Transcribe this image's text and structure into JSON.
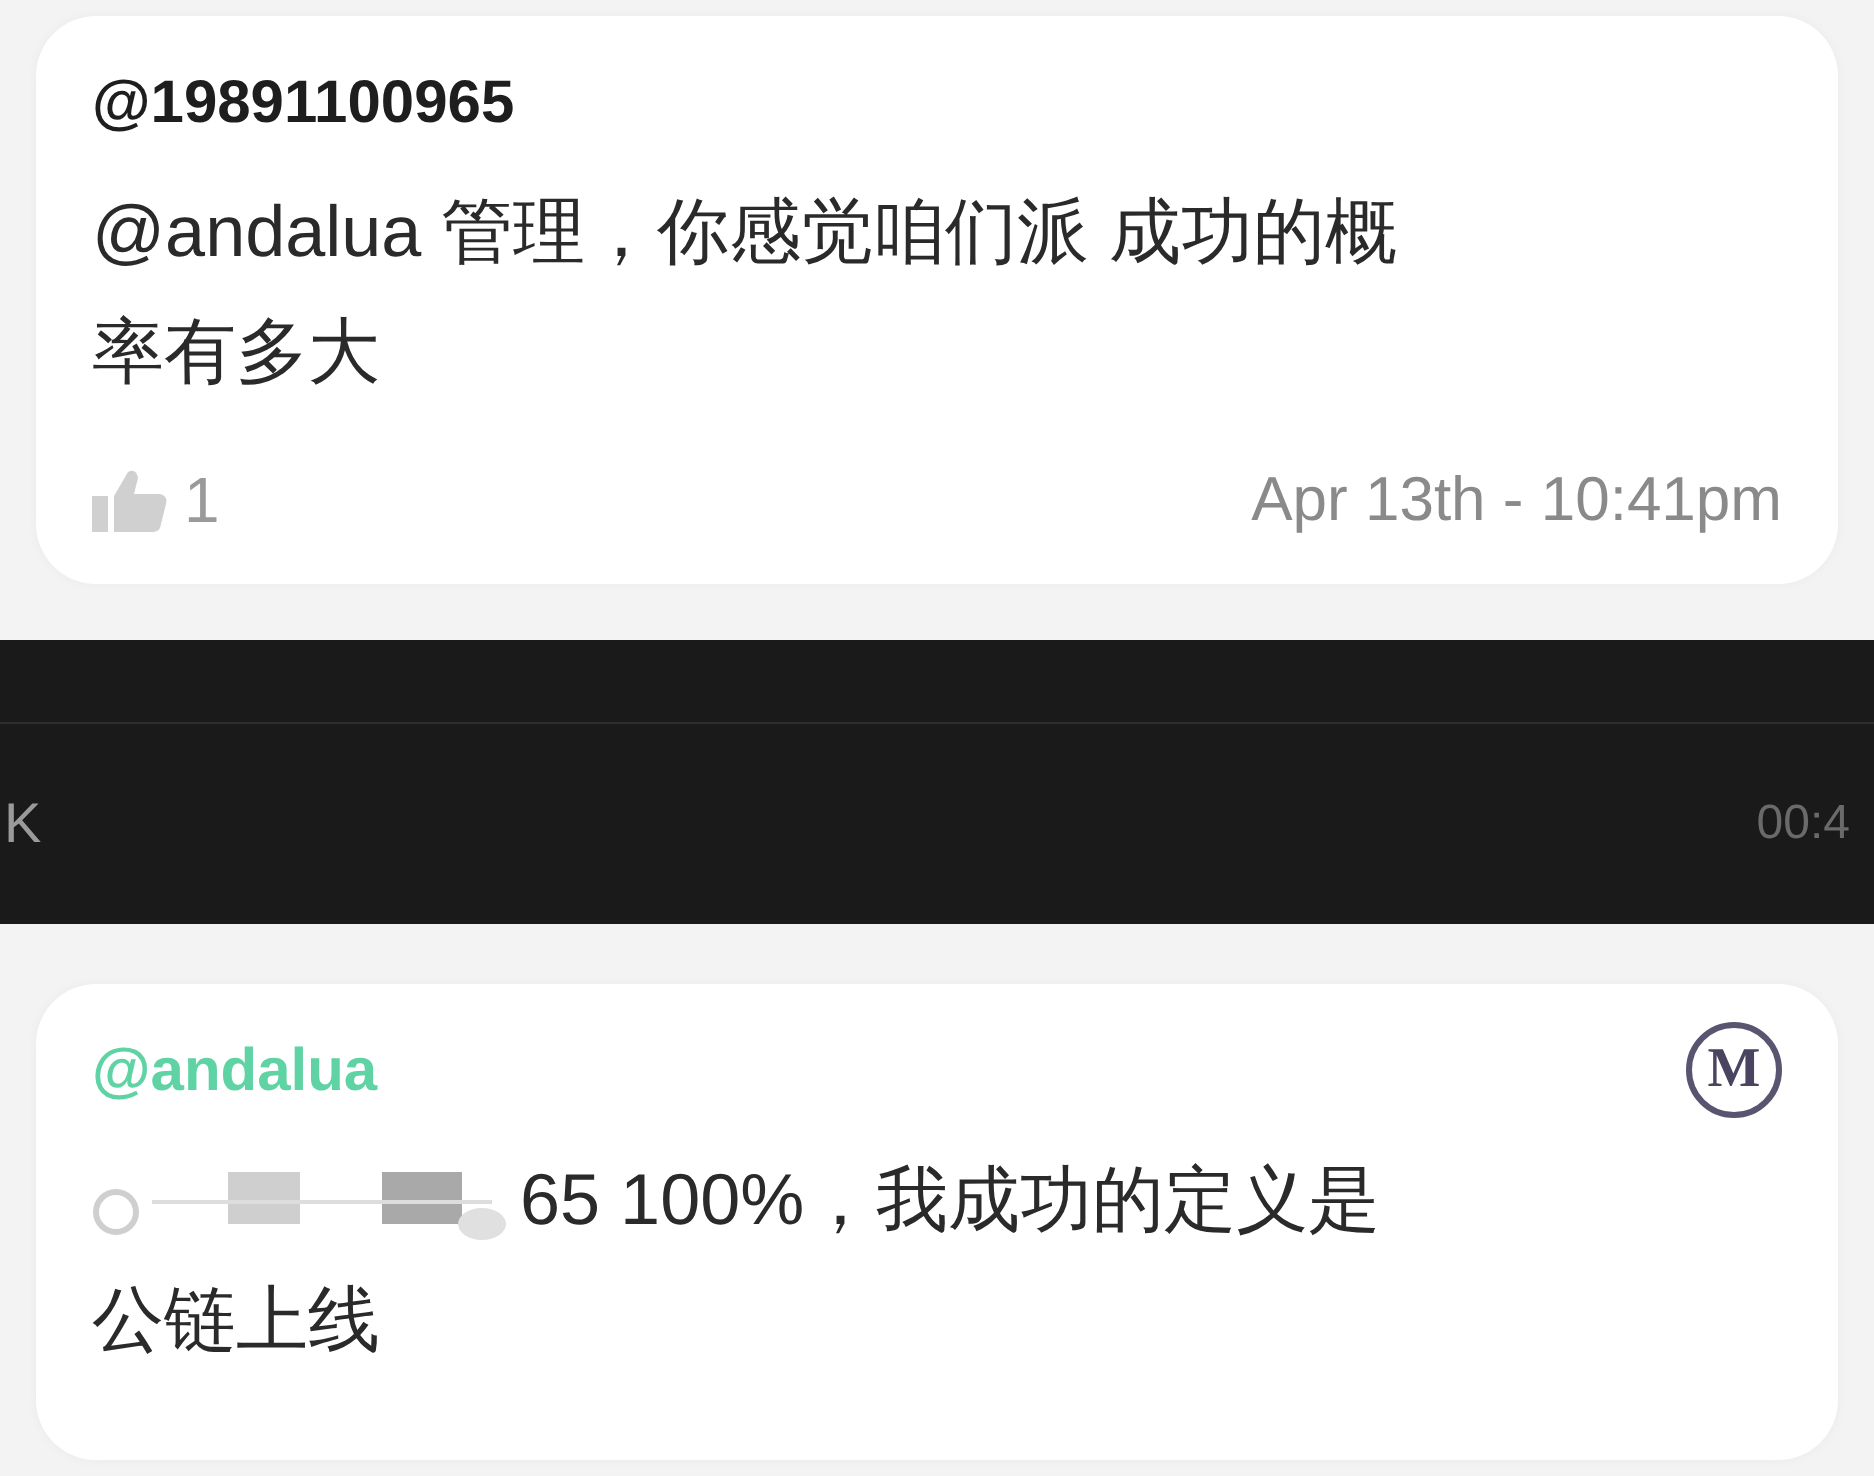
{
  "messages": [
    {
      "author": "@19891100965",
      "moderator": false,
      "text_lines": [
        "@andalua 管理，你感觉咱们派 成功的概",
        "率有多大"
      ],
      "likes": "1",
      "time": "Apr 13th - 10:41pm"
    },
    {
      "author": "@andalua",
      "moderator": true,
      "badge": "M",
      "redacted": true,
      "text_lines": [
        "65 100%，我成功的定义是",
        "公链上线"
      ]
    }
  ],
  "player_bar": {
    "left": "K",
    "right": "00:4"
  }
}
